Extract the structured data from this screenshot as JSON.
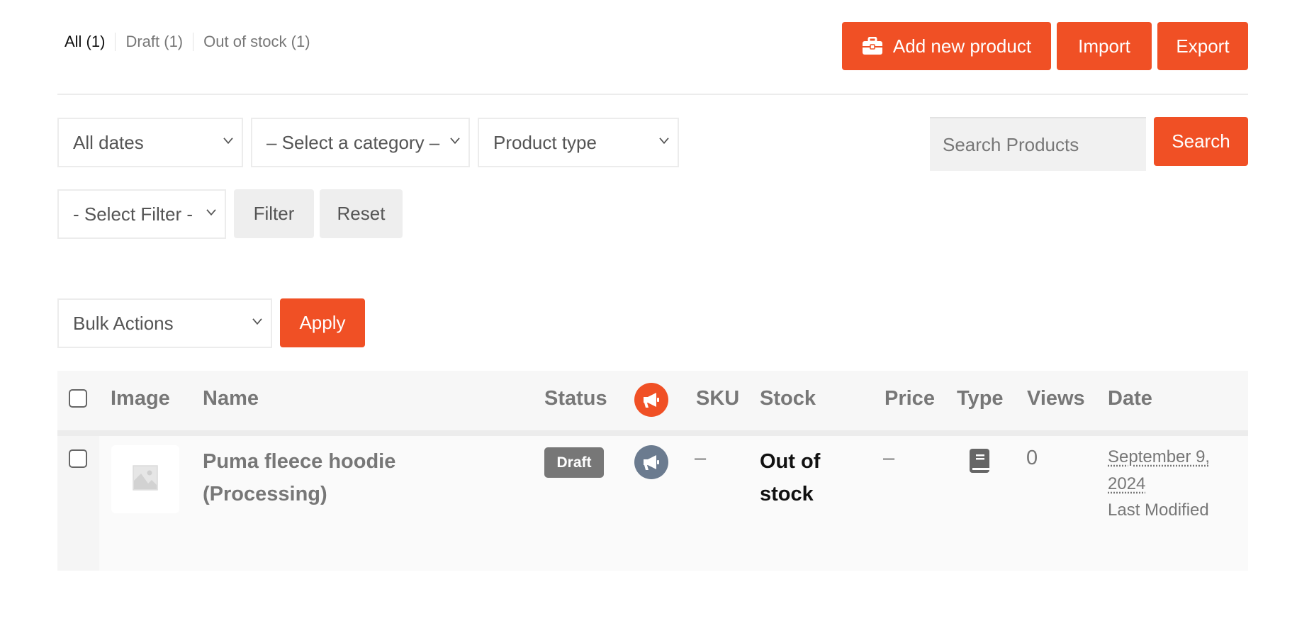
{
  "status_links": [
    {
      "label": "All",
      "count": "(1)",
      "text": "All (1)",
      "current": true
    },
    {
      "label": "Draft",
      "count": "(1)",
      "text": "Draft (1)",
      "current": false
    },
    {
      "label": "Out of stock",
      "count": "(1)",
      "text": "Out of stock (1)",
      "current": false
    }
  ],
  "toolbar": {
    "add_new_label": "Add new product",
    "add_new_icon": "briefcase-icon",
    "import_label": "Import",
    "export_label": "Export"
  },
  "filters": {
    "dates_selected": "All dates",
    "category_selected": "– Select a category –",
    "product_type_selected": "Product type",
    "select_filter_selected": "- Select Filter -",
    "filter_label": "Filter",
    "reset_label": "Reset"
  },
  "search": {
    "placeholder": "Search Products",
    "value": "",
    "button_label": "Search"
  },
  "bulk": {
    "selected": "Bulk Actions",
    "apply_label": "Apply"
  },
  "colors": {
    "accent": "#f05025",
    "badge_draft": "#777777",
    "promote_inactive": "#6b7b8f"
  },
  "table": {
    "columns": [
      "Image",
      "Name",
      "Status",
      "promote-icon",
      "SKU",
      "Stock",
      "Price",
      "Type",
      "Views",
      "Date"
    ],
    "headers": {
      "image": "Image",
      "name": "Name",
      "status": "Status",
      "sku": "SKU",
      "stock": "Stock",
      "price": "Price",
      "type": "Type",
      "views": "Views",
      "date": "Date"
    },
    "rows": [
      {
        "image": "placeholder-image-icon",
        "name_line1": "Puma fleece hoodie",
        "name_line2": "(Processing)",
        "status": "Draft",
        "promote_icon": "megaphone-icon",
        "sku": "–",
        "stock_line1": "Out of",
        "stock_line2": "stock",
        "price": "–",
        "type_icon": "book-icon",
        "views": "0",
        "date_line1": "September 9,",
        "date_line2": "2024",
        "date_label": "Last Modified"
      }
    ]
  }
}
